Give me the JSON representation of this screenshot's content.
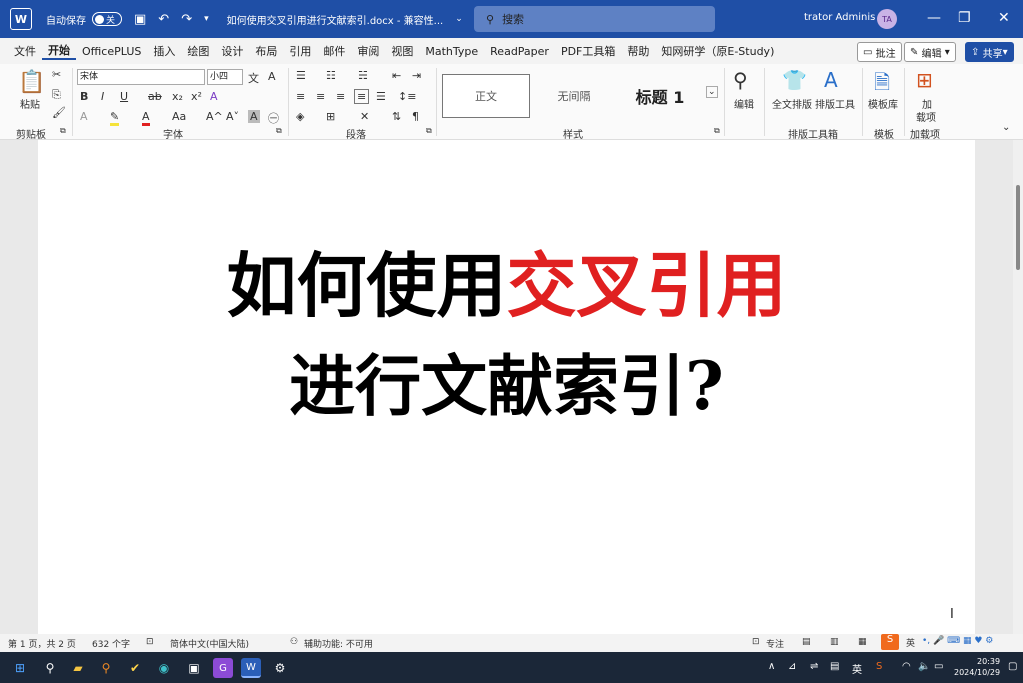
{
  "titlebar": {
    "app_icon": "word-icon",
    "autosave_label": "自动保存",
    "autosave_state": "关",
    "document_title": "如何使用交叉引用进行文献索引.docx - 兼容性...",
    "search_placeholder": "搜索",
    "user_name": "trator Adminis",
    "user_initials": "TA"
  },
  "menu": {
    "items": [
      "文件",
      "开始",
      "OfficePLUS",
      "插入",
      "绘图",
      "设计",
      "布局",
      "引用",
      "邮件",
      "审阅",
      "视图",
      "MathType",
      "ReadPaper",
      "PDF工具箱",
      "帮助",
      "知网研学（原E-Study)"
    ],
    "active_item": "开始",
    "comment_label": "批注",
    "edit_label": "编辑",
    "share_label": "共享"
  },
  "ribbon": {
    "clipboard": {
      "paste_label": "粘贴",
      "group_label": "剪贴板"
    },
    "font": {
      "font_name": "宋体",
      "font_size": "小四",
      "bold": "B",
      "italic": "I",
      "underline": "U",
      "strike": "ab",
      "subscript": "x₂",
      "superscript": "x²",
      "grow": "A^",
      "shrink": "A˅",
      "case": "Aa",
      "group_label": "字体"
    },
    "paragraph": {
      "group_label": "段落"
    },
    "styles": {
      "normal": "正文",
      "no_spacing": "无间隔",
      "heading1": "标题 1",
      "group_label": "样式"
    },
    "editing": {
      "label": "编辑"
    },
    "layout_tools": {
      "full_layout": "全文排版",
      "layout_tool": "排版工具",
      "group_label": "排版工具箱"
    },
    "templates": {
      "label": "模板库",
      "group_label": "模板"
    },
    "addins": {
      "label1": "加",
      "label2": "载项",
      "group_label": "加载项"
    }
  },
  "document": {
    "line1_black": "如何使用",
    "line1_red": "交叉引用",
    "line2": "进行文献索引?",
    "highlight_color": "#e02020"
  },
  "statusbar": {
    "page": "第 1 页，共 2 页",
    "word_count": "632 个字",
    "language": "简体中文(中国大陆)",
    "accessibility": "辅助功能: 不可用",
    "focus": "专注"
  },
  "tray": {
    "input_lang": "英",
    "ime": "英",
    "time": "20:39",
    "date": "2024/10/29"
  },
  "colors": {
    "accent": "#1f4fa6",
    "taskbar": "#1b2738"
  }
}
